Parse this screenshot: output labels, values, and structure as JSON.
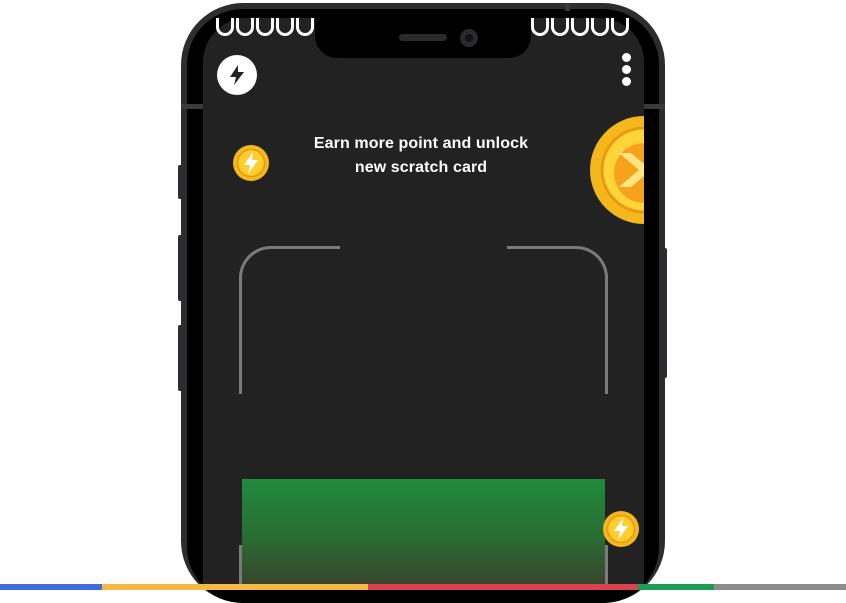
{
  "headline": {
    "line1": "Earn more point and unlock",
    "line2": "new scratch card"
  },
  "icons": {
    "top_left": "flash-icon",
    "top_right": "more-vertical-icon",
    "coins": "lightning-coin-icon",
    "large_coin": "large-coin-icon"
  },
  "colors": {
    "screen_background": "#222222",
    "card_top": "#1f8a3b",
    "card_bottom": "#3a3f2b",
    "coin": "#f5b81c",
    "bottom_bar": [
      "#3f6be0",
      "#f7b943",
      "#d9434e",
      "#1f9c53",
      "#8c8c8c"
    ]
  }
}
